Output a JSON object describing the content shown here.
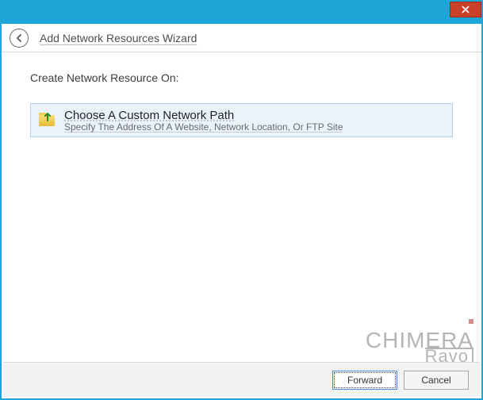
{
  "window": {
    "close_tooltip": "Close"
  },
  "header": {
    "title": "Add Network Resources Wizard"
  },
  "content": {
    "instruction": "Create Network Resource On:",
    "option": {
      "title": "Choose A Custom Network Path",
      "description": "Specify The Address Of A Website, Network Location, Or FTP Site"
    }
  },
  "footer": {
    "forward_label": "Forward",
    "cancel_label": "Cancel"
  },
  "watermark": {
    "line1": "CHIMERA",
    "line2": "Ravo"
  }
}
